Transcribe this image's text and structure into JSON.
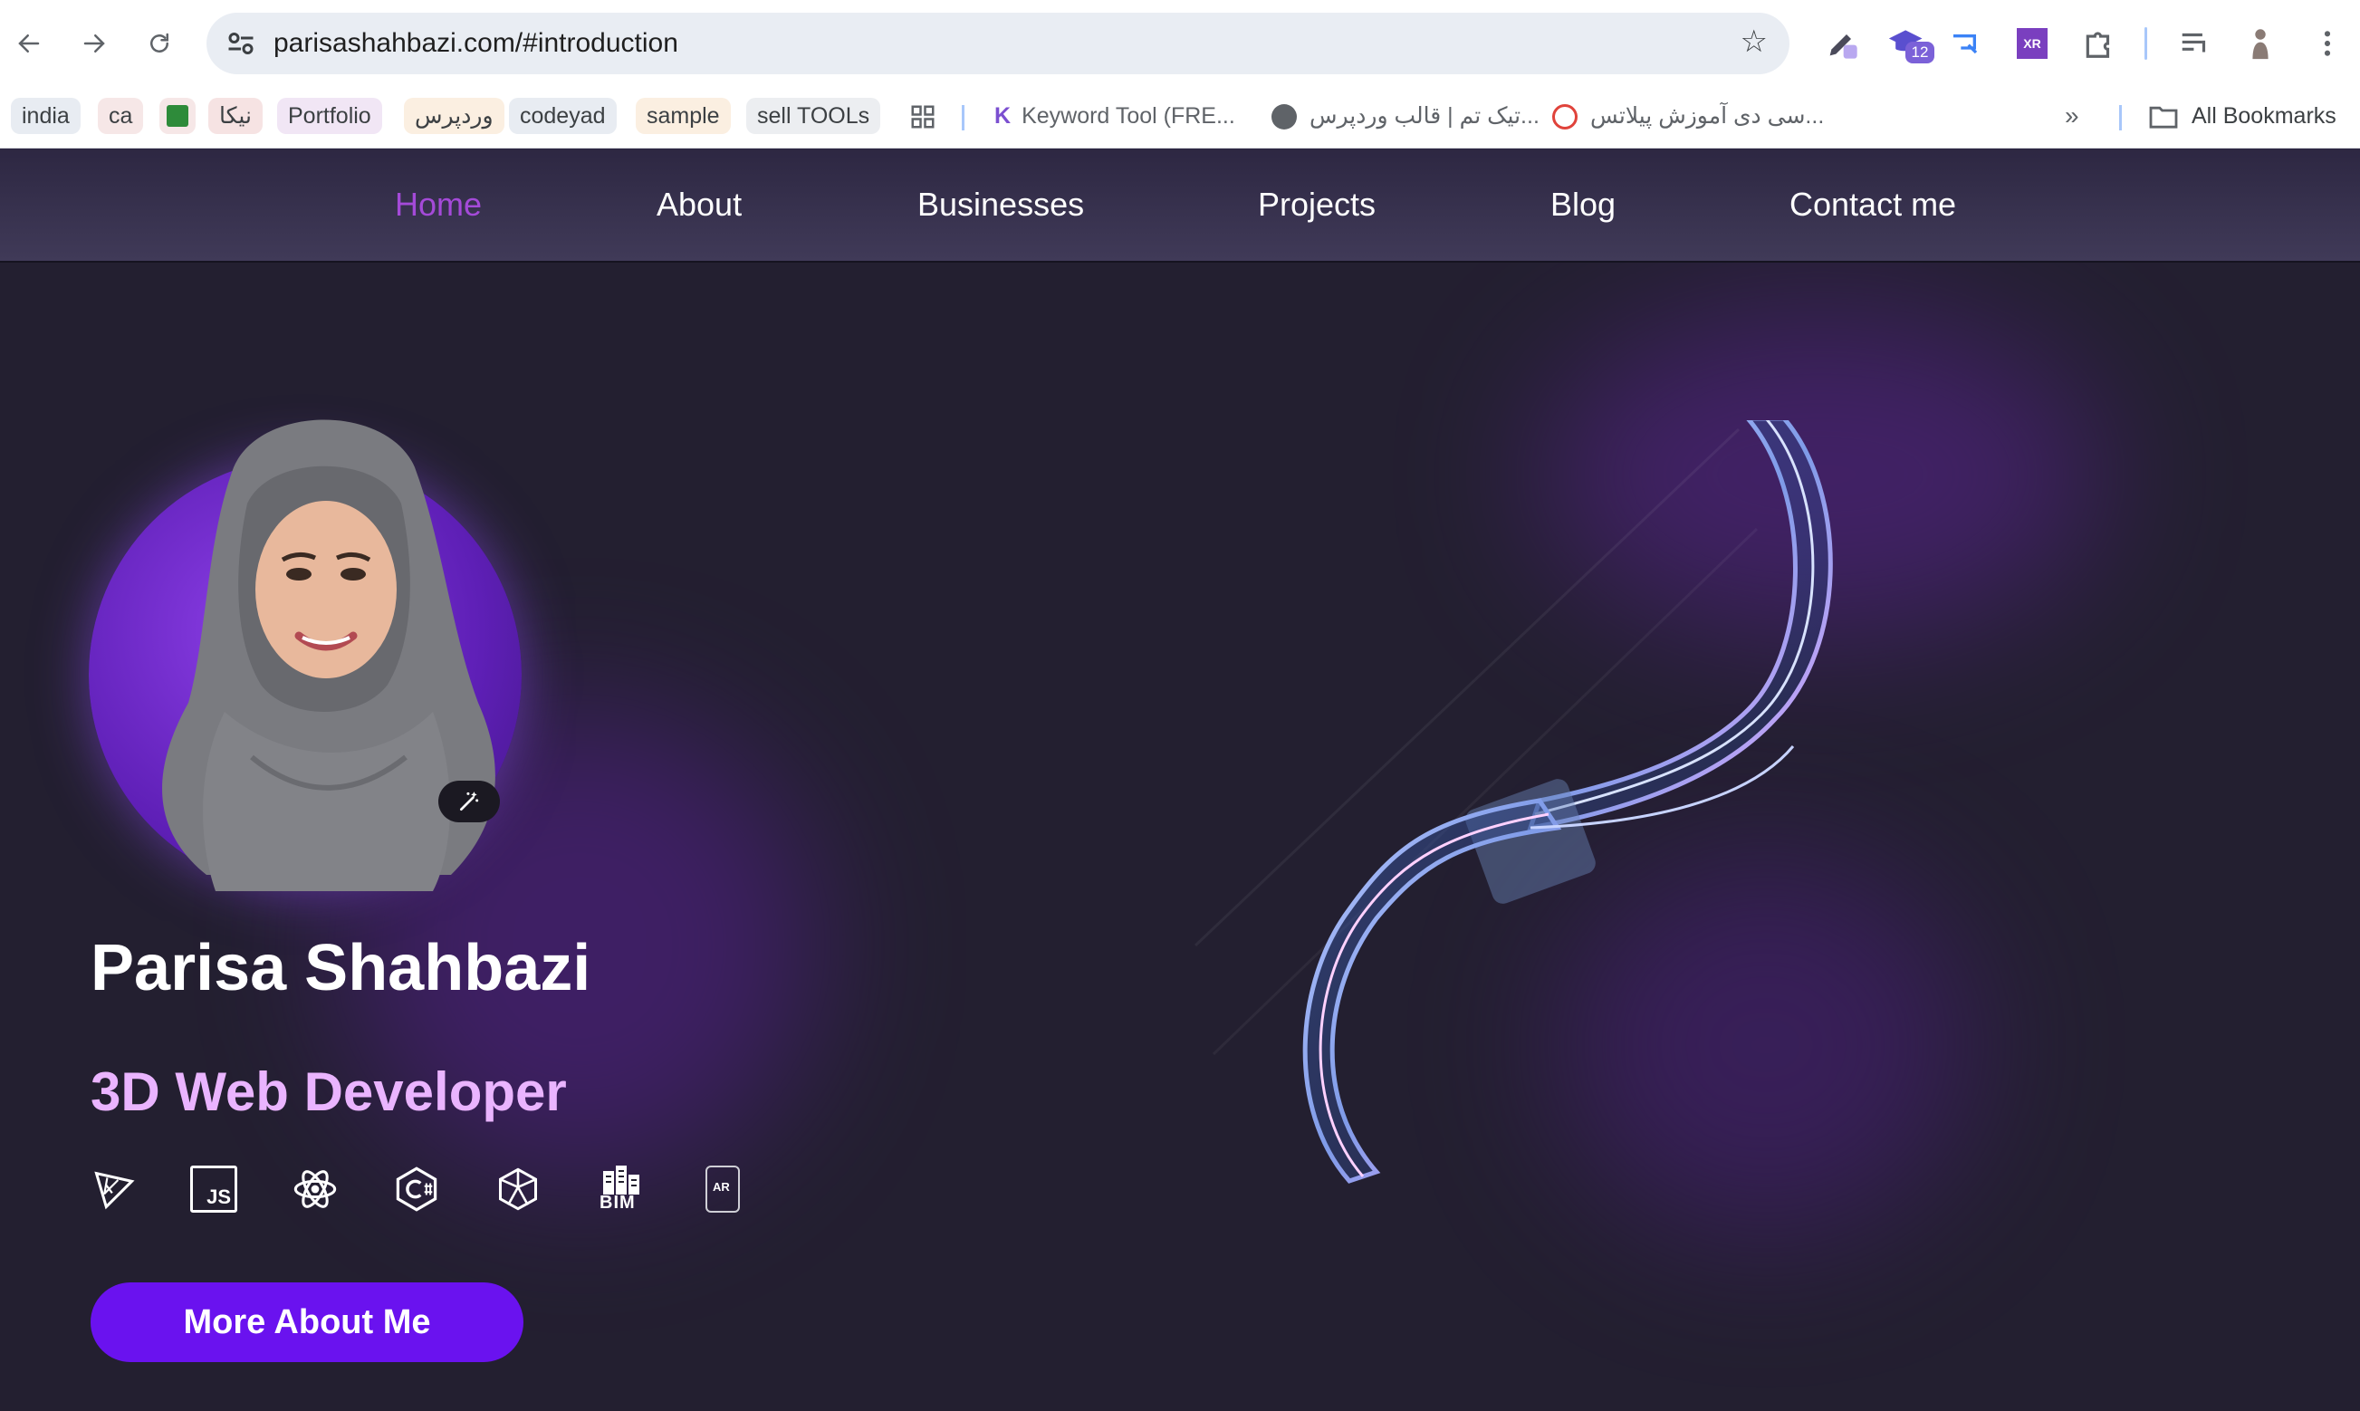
{
  "browser": {
    "url": "parisashahbazi.com/#introduction",
    "extension_badge": "12",
    "xr_label": "XR",
    "bookmarks": [
      {
        "label": "india"
      },
      {
        "label": "ca"
      },
      {
        "label": "نیکا"
      },
      {
        "label": "Portfolio"
      },
      {
        "label": "وردپرس"
      },
      {
        "label": "codeyad"
      },
      {
        "label": "sample"
      },
      {
        "label": "sell TOOLs"
      },
      {
        "label": "Keyword Tool (FRE..."
      },
      {
        "label": "تیک تم | قالب وردپرس..."
      },
      {
        "label": "سی دی آموزش پیلاتس..."
      }
    ],
    "all_bookmarks": "All Bookmarks"
  },
  "site": {
    "nav": [
      {
        "label": "Home",
        "active": true
      },
      {
        "label": "About"
      },
      {
        "label": "Businesses"
      },
      {
        "label": "Projects"
      },
      {
        "label": "Blog"
      },
      {
        "label": "Contact me"
      }
    ],
    "hero": {
      "name": "Parisa Shahbazi",
      "role": "3D Web Developer",
      "cta": "More About Me",
      "tech_icons": [
        "threejs-icon",
        "javascript-icon",
        "react-icon",
        "csharp-icon",
        "unity-icon",
        "bim-icon",
        "ar-icon"
      ],
      "js_label": "JS",
      "bim_label": "BIM",
      "ar_label": "AR"
    },
    "colors": {
      "accent": "#6a12ef",
      "nav_active": "#a44ad8",
      "role_text": "#eab4ff",
      "background": "#231f30"
    }
  }
}
